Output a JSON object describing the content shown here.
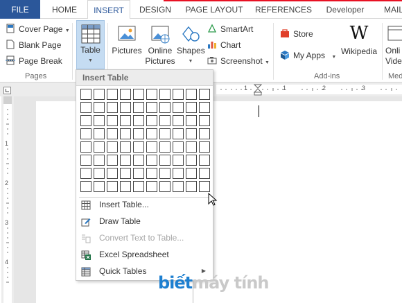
{
  "tabs": [
    {
      "label": "FILE"
    },
    {
      "label": "HOME"
    },
    {
      "label": "INSERT"
    },
    {
      "label": "DESIGN"
    },
    {
      "label": "PAGE LAYOUT"
    },
    {
      "label": "REFERENCES"
    },
    {
      "label": "Developer"
    },
    {
      "label": "MAIL"
    }
  ],
  "ribbon": {
    "pages": {
      "cover_page": "Cover Page",
      "blank_page": "Blank Page",
      "page_break": "Page Break",
      "group_label": "Pages"
    },
    "table": {
      "label": "Table"
    },
    "illustrations": {
      "pictures": "Pictures",
      "online_pictures_line1": "Online",
      "online_pictures_line2": "Pictures",
      "shapes": "Shapes",
      "smartart": "SmartArt",
      "chart": "Chart",
      "screenshot": "Screenshot"
    },
    "addins": {
      "store": "Store",
      "my_apps": "My Apps",
      "wikipedia": "Wikipedia",
      "group_label": "Add-ins"
    },
    "media": {
      "online_video_line1": "Onli",
      "online_video_line2": "Vide",
      "group_label": "Med"
    }
  },
  "dropdown": {
    "title": "Insert Table",
    "grid_columns": 10,
    "grid_rows": 8,
    "items": [
      {
        "label": "Insert Table...",
        "icon": "table-icon",
        "disabled": false
      },
      {
        "label": "Draw Table",
        "icon": "pencil-icon",
        "disabled": false
      },
      {
        "label": "Convert Text to Table...",
        "icon": "convert-icon",
        "disabled": true
      },
      {
        "label": "Excel Spreadsheet",
        "icon": "excel-icon",
        "disabled": false
      },
      {
        "label": "Quick Tables",
        "icon": "quick-tables-icon",
        "disabled": false
      }
    ]
  },
  "ruler": {
    "numbers": [
      "1",
      "1",
      "2",
      "3"
    ]
  },
  "vruler": {
    "numbers": [
      "1",
      "2",
      "3",
      "4"
    ]
  },
  "watermark": {
    "part1": "biết",
    "part2": "máy tính"
  },
  "colors": {
    "file_tab": "#2b579a",
    "accent_red": "#e81123",
    "table_button_bg": "#c5dcf2",
    "watermark_blue": "#1d7fd0"
  }
}
